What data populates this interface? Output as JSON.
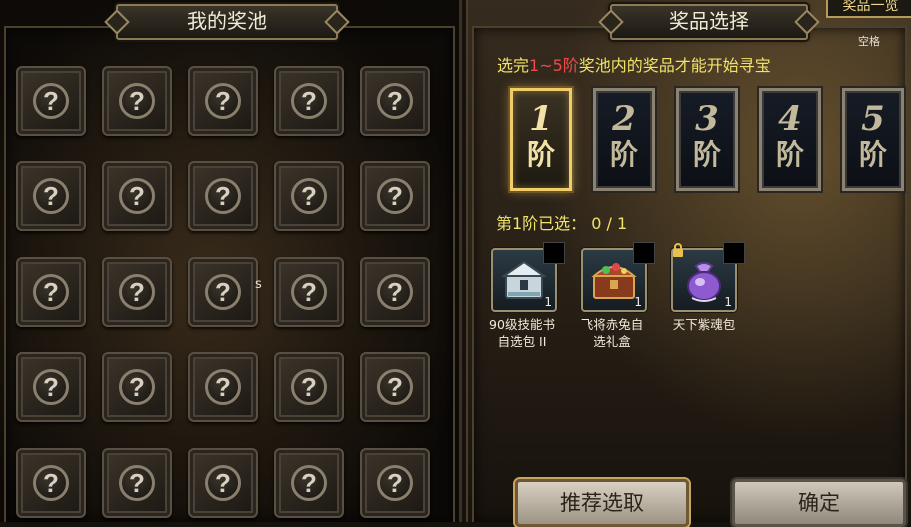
{
  "left_panel": {
    "title": "我的奖池",
    "slot_symbol": "?",
    "rows": 5,
    "cols": 5,
    "stray_text": "s"
  },
  "right_panel": {
    "title": "奖品选择",
    "prize_list_tab": "奖品一览",
    "space_hint": "空格",
    "instruction": {
      "before": "选完",
      "highlight": "1~5阶",
      "after": "奖池内的奖品才能开始寻宝"
    },
    "tiers": [
      {
        "num": "1",
        "char": "阶",
        "active": true
      },
      {
        "num": "2",
        "char": "阶",
        "active": false
      },
      {
        "num": "3",
        "char": "阶",
        "active": false
      },
      {
        "num": "4",
        "char": "阶",
        "active": false
      },
      {
        "num": "5",
        "char": "阶",
        "active": false
      }
    ],
    "status": "第1阶已选： 0 / 1",
    "items": [
      {
        "name_line1": "90级技能书",
        "name_line2": "自选包 II",
        "count": "1",
        "icon": "skill-book-chest-icon",
        "locked": false
      },
      {
        "name_line1": "飞将赤兔自",
        "name_line2": "选礼盒",
        "count": "1",
        "icon": "treasure-chest-icon",
        "locked": false
      },
      {
        "name_line1": "天下紫魂包",
        "name_line2": "",
        "count": "1",
        "icon": "purple-soul-bag-icon",
        "locked": true
      }
    ],
    "buttons": {
      "recommend": "推荐选取",
      "confirm": "确定"
    }
  },
  "colors": {
    "instruction_text": "#f0e36a",
    "highlight": "#f04a4a",
    "active_tier_border": "#f0cc6a"
  }
}
